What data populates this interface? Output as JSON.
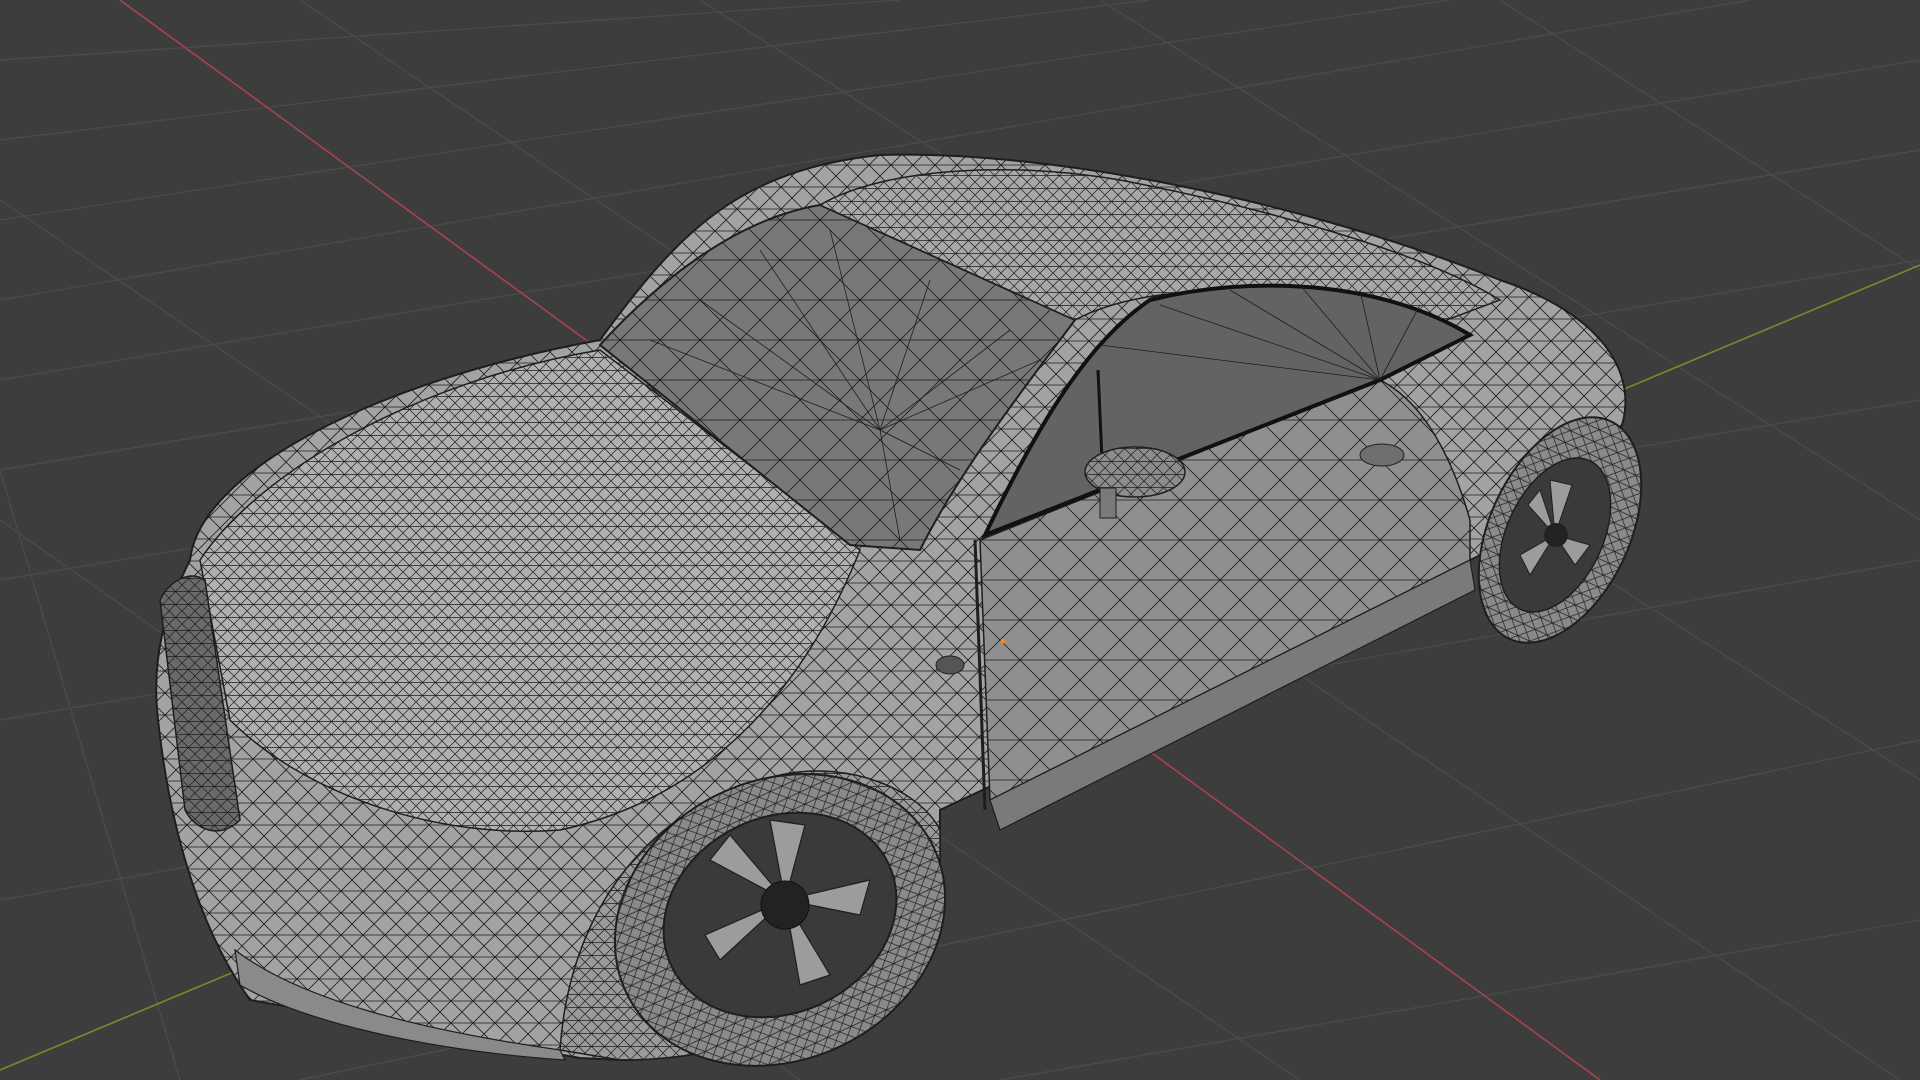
{
  "viewport": {
    "editor": "3D Viewport",
    "shading": "solid",
    "overlay": "wireframe",
    "object": "car-model",
    "background_color": "#3d3d3d",
    "grid_color": "#4c4c4c",
    "x_axis_color": "#a8434a",
    "y_axis_color": "#6f8f2c",
    "mesh_fill_color": "#a3a3a3",
    "wire_color": "#1e1e1e",
    "origin_color": "#f08a24"
  }
}
